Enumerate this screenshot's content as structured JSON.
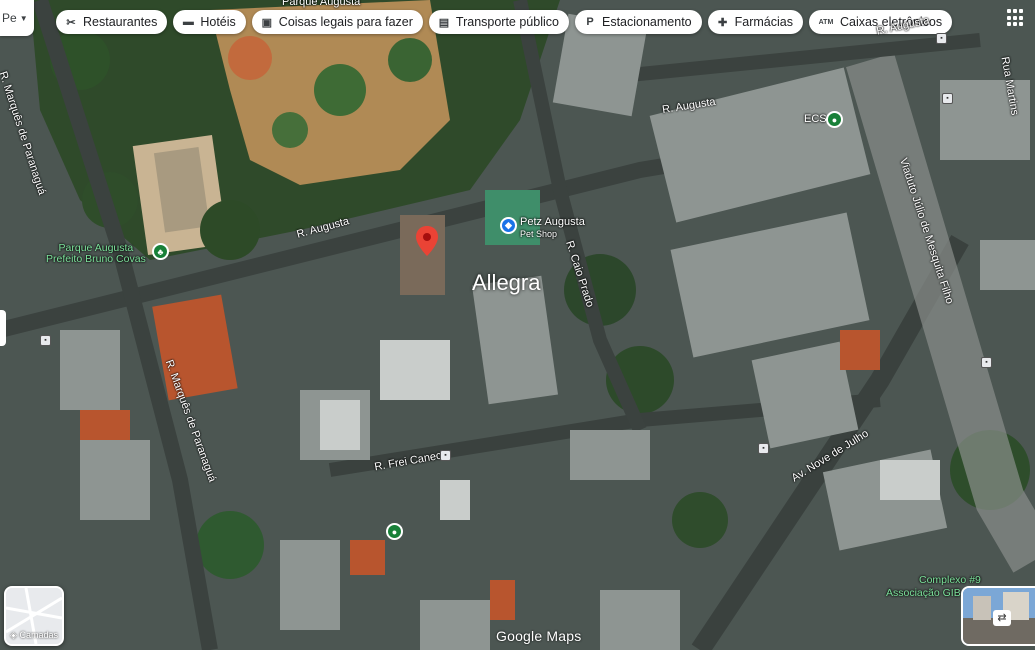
{
  "search": {
    "text": "Pe"
  },
  "chips": [
    {
      "label": "Restaurantes",
      "icon": "fork-knife-icon",
      "glyph": "✂"
    },
    {
      "label": "Hotéis",
      "icon": "bed-icon",
      "glyph": "▬"
    },
    {
      "label": "Coisas legais para fazer",
      "icon": "camera-icon",
      "glyph": "▣"
    },
    {
      "label": "Transporte público",
      "icon": "train-icon",
      "glyph": "▤"
    },
    {
      "label": "Estacionamento",
      "icon": "parking-icon",
      "glyph": "P"
    },
    {
      "label": "Farmácias",
      "icon": "pharmacy-icon",
      "glyph": "✚"
    },
    {
      "label": "Caixas eletrônicos",
      "icon": "atm-icon",
      "glyph": "ATM"
    }
  ],
  "map": {
    "place_label": "Allegra",
    "streets": {
      "marques_de_paranagua_top": "R. Marquês de Paranaguá",
      "marques_de_paranagua": "R. Marquês de Paranaguá",
      "augusta_left": "R. Augusta",
      "augusta_right": "R. Augusta",
      "augusta_top": "R. Augusta",
      "caio_prado": "R. Caio Prado",
      "frei_caneca": "R. Frei Caneca",
      "nove_de_julho": "Av. Nove de Julho",
      "viaduto": "Viaduto Júlio de Mesquita Filho",
      "rua_martins": "Rua Martins"
    },
    "pois": {
      "parque_augusta_top": "Parque Augusta",
      "parque_augusta": "Parque Augusta\nPrefeito Bruno Covas",
      "petz_name": "Petz Augusta",
      "petz_sub": "Pet Shop",
      "ecs": "ECS",
      "complexo": "Complexo #9",
      "associacao": "Associação GIB"
    }
  },
  "layers": {
    "label": "Camadas"
  },
  "attribution": "Google Maps",
  "colors": {
    "marker": "#ea4335",
    "park_green": "#188038",
    "shop_blue": "#1a73e8"
  }
}
